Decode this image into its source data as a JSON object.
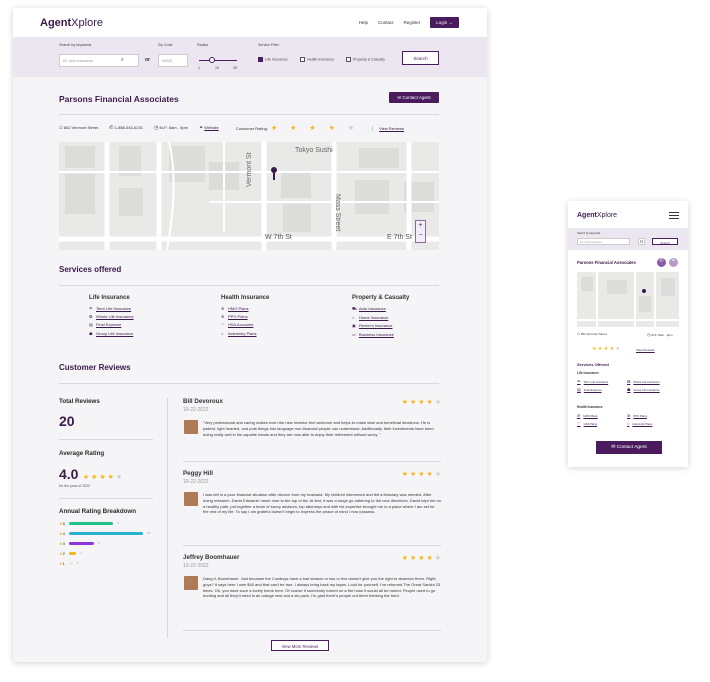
{
  "brand": {
    "strong": "Agent",
    "rest": "Xplore"
  },
  "nav": {
    "help": "Help",
    "contact": "Contact",
    "register": "Register",
    "login": "Login →"
  },
  "filters": {
    "keywords_label": "Search by keywords",
    "keywords_placeholder": "Ex. Auto Insurance",
    "or": "or",
    "zip_label": "Zip Code",
    "zip_placeholder": "90043",
    "radius_label": "Radius",
    "radius_ticks": [
      "1",
      "10",
      "25"
    ],
    "radius_value": 0.35,
    "service_label": "Service Filter",
    "services": [
      {
        "label": "Life Insurance",
        "checked": true
      },
      {
        "label": "Health Insurance",
        "checked": false
      },
      {
        "label": "Property & Casualty",
        "checked": false
      }
    ],
    "search_button": "Search"
  },
  "agency": {
    "name": "Parsons Financial Associates",
    "contact_button": "Contact Agent",
    "address": "652 Vermont Street",
    "phone": "1-888-543-6231",
    "hours": "M-F: 8am - 5pm",
    "website": "Website",
    "rating_label": "Consumer Rating:",
    "rating": 4,
    "view_reviews": "View Reviews"
  },
  "map": {
    "labels": {
      "tokyo": "Tokyo Sushi",
      "vermont": "Vermont St",
      "mass": "Mass Street",
      "w7": "W 7th St",
      "e7": "E 7th St"
    },
    "zoom_in": "+",
    "zoom_out": "−"
  },
  "services": {
    "title": "Services offered",
    "columns": [
      {
        "title": "Life Insurance",
        "items": [
          {
            "icon": "umbrella-icon",
            "glyph": "☂",
            "label": "Term Life Insurance"
          },
          {
            "icon": "heart-badge-icon",
            "glyph": "❂",
            "label": "Whole Life Insurance"
          },
          {
            "icon": "document-icon",
            "glyph": "▤",
            "label": "Final Expense"
          },
          {
            "icon": "group-icon",
            "glyph": "☗",
            "label": "Group Life Insurance"
          }
        ]
      },
      {
        "title": "Health Insurance",
        "items": [
          {
            "icon": "medical-icon",
            "glyph": "✲",
            "label": "HMO Plans"
          },
          {
            "icon": "medical-icon",
            "glyph": "✲",
            "label": "PPO Plans"
          },
          {
            "icon": "heart-icon",
            "glyph": "♡",
            "label": "HSA Accounts"
          },
          {
            "icon": "lock-icon",
            "glyph": "⌂",
            "label": "Indemnity Plans"
          }
        ]
      },
      {
        "title": "Property & Casualty",
        "items": [
          {
            "icon": "car-icon",
            "glyph": "⛟",
            "label": "Auto Insurance"
          },
          {
            "icon": "home-icon",
            "glyph": "⌂",
            "label": "Home Insurance"
          },
          {
            "icon": "renters-icon",
            "glyph": "▣",
            "label": "Renter's Insurance"
          },
          {
            "icon": "business-icon",
            "glyph": "▭",
            "label": "Business Insurance"
          }
        ]
      }
    ]
  },
  "reviews": {
    "title": "Customer Reviews",
    "total_label": "Total Reviews",
    "total": "20",
    "avg_label": "Average Rating",
    "avg": "4.0",
    "avg_stars": 4,
    "avg_note": "for the year of 2022",
    "breakdown_label": "Annual Rating Breakdown",
    "breakdown": [
      {
        "star": "5",
        "count": "5",
        "fraction": 0.6,
        "color": "#22c18a"
      },
      {
        "star": "4",
        "count": "10",
        "fraction": 1.0,
        "color": "#27b2d1"
      },
      {
        "star": "3",
        "count": "3",
        "fraction": 0.34,
        "color": "#8d36e0"
      },
      {
        "star": "2",
        "count": "1",
        "fraction": 0.1,
        "color": "#f1b81b"
      },
      {
        "star": "1",
        "count": "1",
        "fraction": 0.03,
        "color": "#e9e9e9"
      }
    ],
    "items": [
      {
        "name": "Bill Devoroux",
        "date": "10-22-2022",
        "stars": 4,
        "text": "\"Very professional and caring makes even the new investor feel welcome and helps to make wise and beneficial decisions. He is patient, light hearted, and puts things into language non-financial people can understand. Additionally, their investments have been doing really well in his capable hands and they are now able to enjoy their retirement without worry. \""
      },
      {
        "name": "Peggy Hill",
        "date": "10-22-2022",
        "stars": 4,
        "text": "I was left in a poor financial situation after divorce from my husband. My children intervened and felt a fiduciary was needed. After doing research, David Edwards' name rose to the top of list. At first, it was a tough go adhering to the new directives. David kept me on a healthy path, put together a team of savvy advisors, top attorneys and with his expertise brought me to a place where I am set for the rest of my life. To say I am grateful doesn't begin to express the peace of mind I now possess."
      },
      {
        "name": "Jeffrey Boomhauer",
        "date": "10-22-2022",
        "stars": 4,
        "text": "Dang it, Boomhauer. Just because the Cowboys have a bad season or two or five doesn't give you the right to abandon them. Right, guys? It says here I owe $40 and that can't be true. I always bring back my tapes. Look for yourself, I've returned The Great Santini 23 times. Oh, you have such a lovely home here. Of course if somebody turned on a fire hose it would all be ruined. People used to go hunting and all they'd need is an orange vest and a six pack. I'm glad there's people out there thinking the herd."
      }
    ],
    "more_button": "View More Reviews"
  },
  "mobile": {
    "search_label": "Search by keywords",
    "search_placeholder": "Ex. Auto Insurance",
    "search_button": "Search",
    "services_title": "Services Offered",
    "life_title": "Life Insurance",
    "life_items": [
      "Term Life Insurance",
      "Whole Life Insurance",
      "Final Expense",
      "Group Life Insurance"
    ],
    "health_title": "Health Insurance",
    "health_items": [
      "HMO Plans",
      "PPO Plans",
      "HSA Plans",
      "Indemnity Plans"
    ],
    "contact": "Contact Agent"
  }
}
